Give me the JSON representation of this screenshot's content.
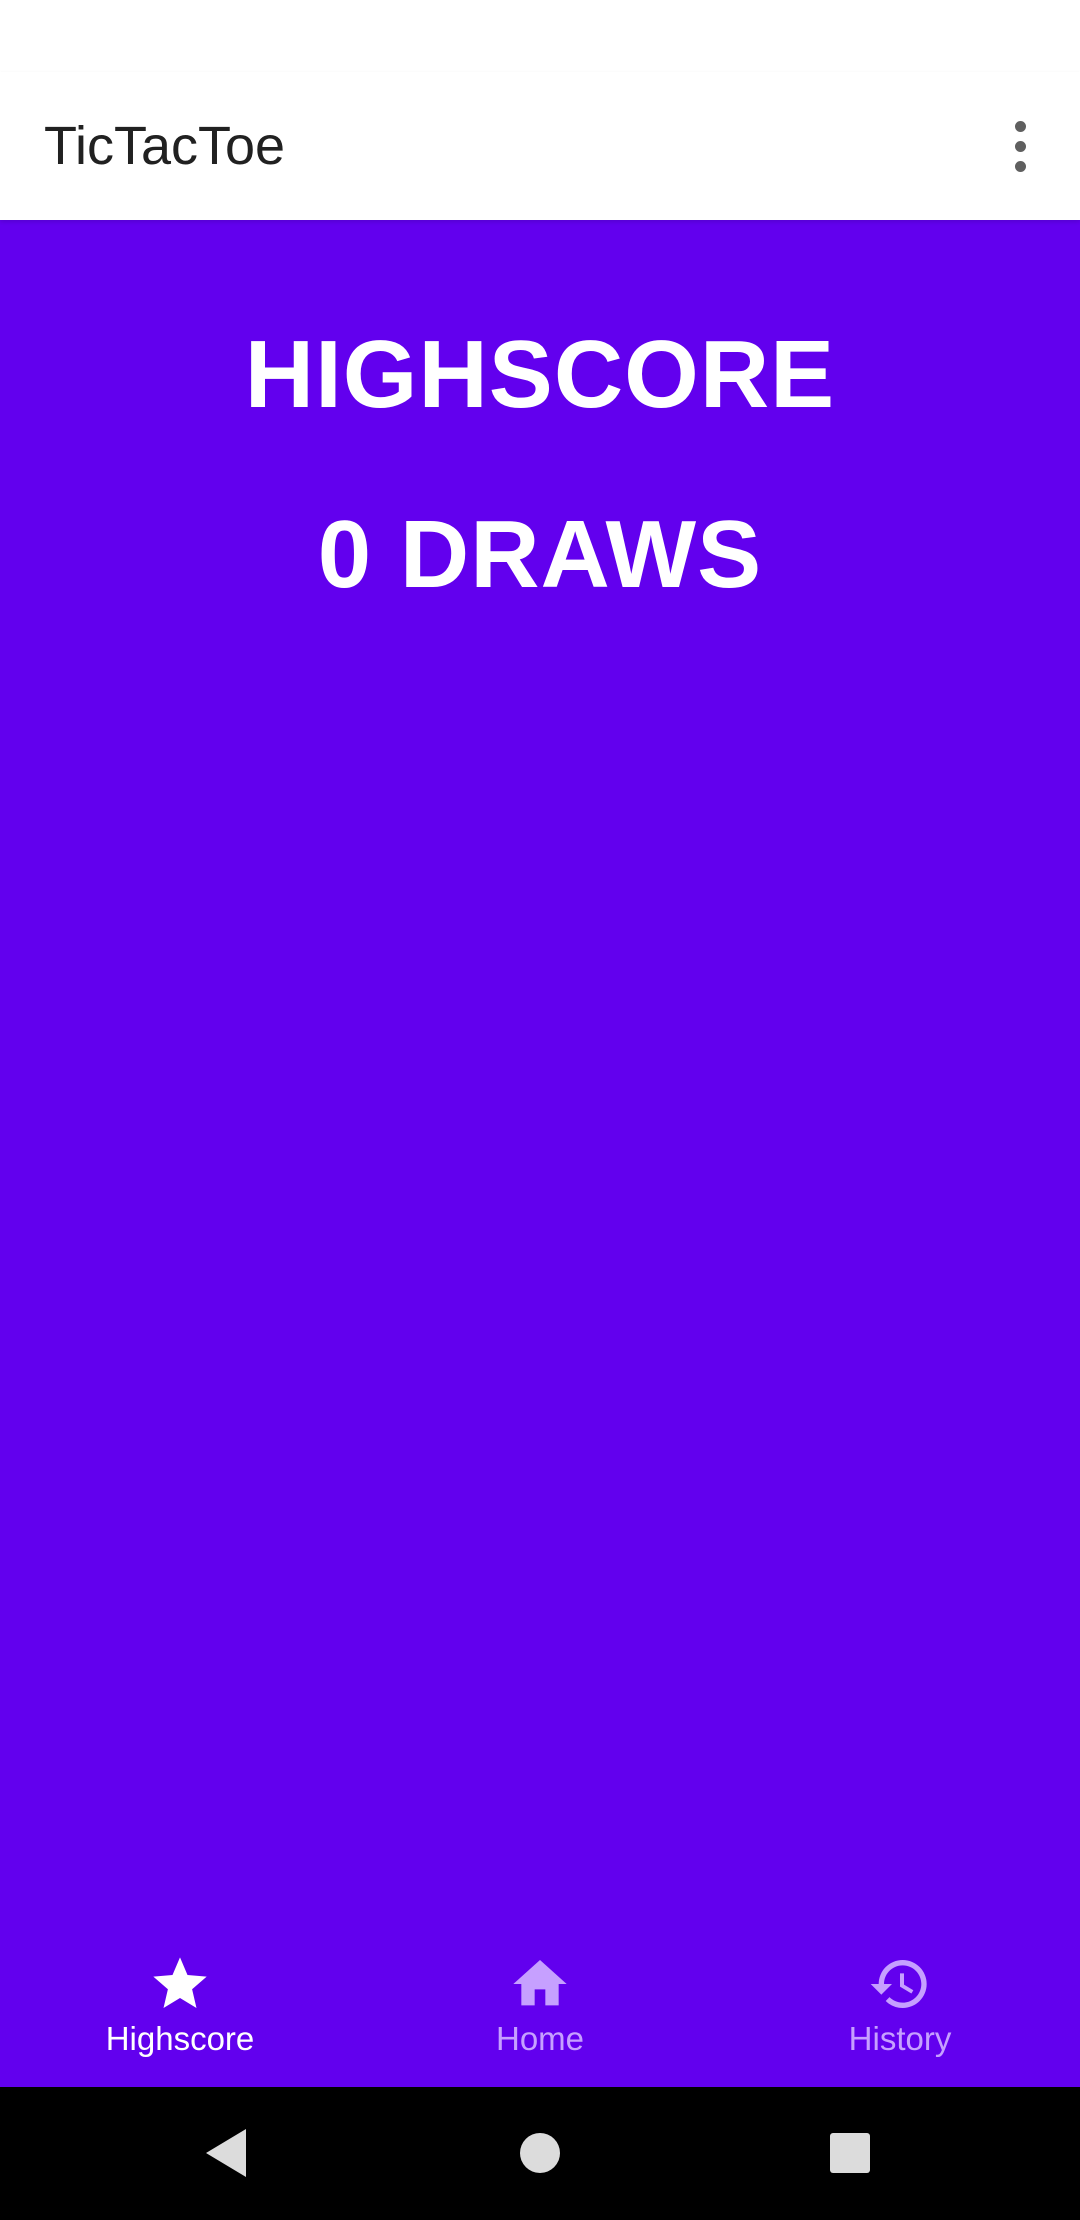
{
  "app": {
    "title": "TicTacToe"
  },
  "main": {
    "heading": "HIGHSCORE",
    "score_text": "0 DRAWS"
  },
  "bottom_nav": {
    "items": [
      {
        "label": "Highscore",
        "icon": "star-icon",
        "active": true
      },
      {
        "label": "Home",
        "icon": "home-icon",
        "active": false
      },
      {
        "label": "History",
        "icon": "history-icon",
        "active": false
      }
    ]
  },
  "colors": {
    "primary": "#6200ee",
    "app_bar": "#ffffff",
    "title_text": "#212121",
    "active_nav": "#ffffff",
    "inactive_nav": "#c6a0ff",
    "system_nav": "#000000"
  }
}
